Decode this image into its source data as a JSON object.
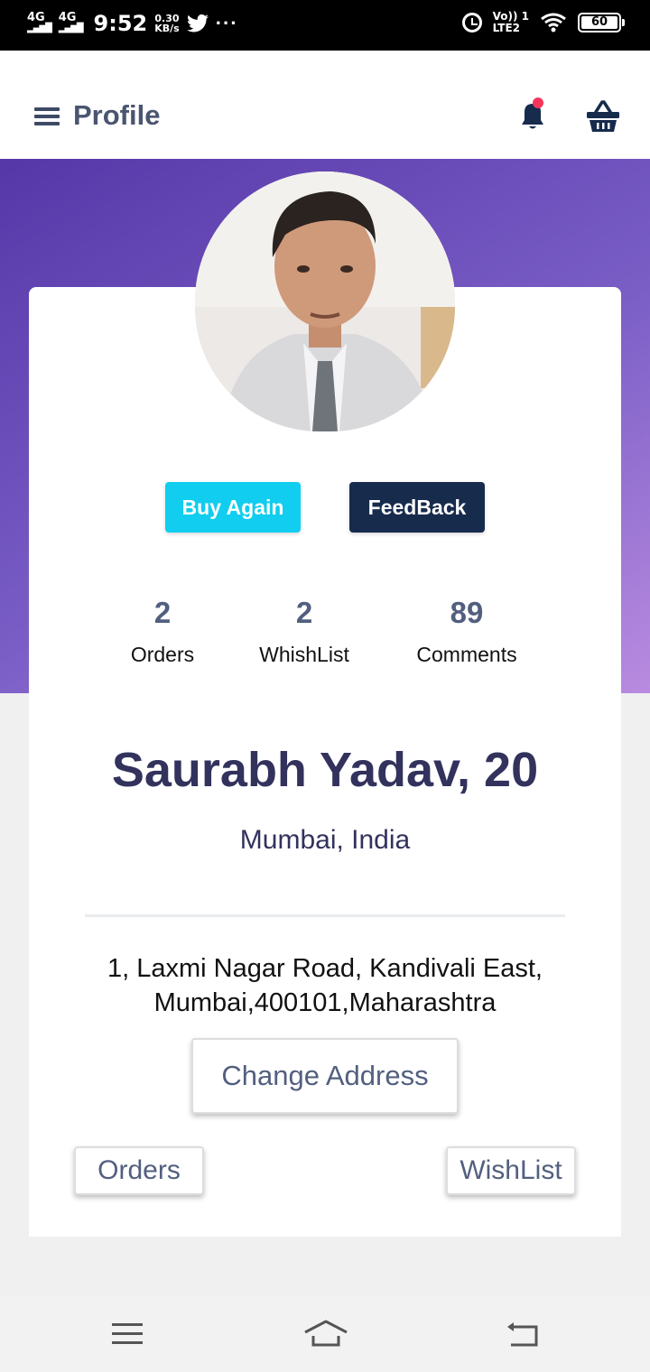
{
  "status_bar": {
    "network1": "4G",
    "network2": "4G",
    "time": "9:52",
    "speed_value": "0.30",
    "speed_unit": "KB/s",
    "volte_top": "Vo)) 1",
    "volte_bottom": "LTE2",
    "battery": "60"
  },
  "app_bar": {
    "title": "Profile"
  },
  "profile": {
    "buy_again_label": "Buy Again",
    "feedback_label": "FeedBack",
    "stats": [
      {
        "value": "2",
        "label": "Orders"
      },
      {
        "value": "2",
        "label": "WhishList"
      },
      {
        "value": "89",
        "label": "Comments"
      }
    ],
    "name": "Saurabh Yadav, 20",
    "location": "Mumbai, India",
    "address_line1": "1, Laxmi Nagar Road, Kandivali East,",
    "address_line2": "Mumbai,400101,Maharashtra",
    "change_address_label": "Change Address",
    "orders_label": "Orders",
    "wishlist_label": "WishList"
  },
  "colors": {
    "accent_cyan": "#11cdef",
    "dark_navy": "#172b4d",
    "notification_dot": "#f5365c",
    "hero_start": "#5637a8",
    "hero_end": "#b98be0"
  },
  "icons": [
    "menu-icon",
    "bell-icon",
    "basket-icon",
    "twitter-icon",
    "alarm-icon",
    "wifi-icon",
    "nav-menu-icon",
    "nav-home-icon",
    "nav-back-icon"
  ]
}
